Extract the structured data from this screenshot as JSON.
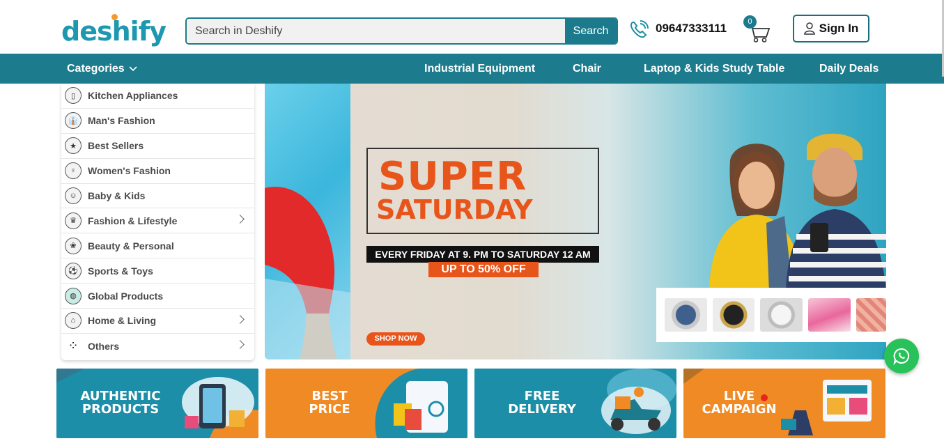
{
  "brand": {
    "logo_text": "deshify",
    "accent": "#1c7b8d",
    "orange": "#e8551b"
  },
  "search": {
    "placeholder": "Search in Deshify",
    "button_label": "Search"
  },
  "contact": {
    "phone": "09647333111",
    "icon": "phone-icon"
  },
  "cart": {
    "count": "0",
    "icon": "cart-icon"
  },
  "account": {
    "signin_label": "Sign In",
    "icon": "user-icon"
  },
  "nav": {
    "categories_label": "Categories",
    "items": [
      {
        "label": "Industrial Equipment"
      },
      {
        "label": "Chair"
      },
      {
        "label": "Laptop & Kids Study Table"
      },
      {
        "label": "Daily Deals"
      }
    ]
  },
  "sidebar": {
    "items": [
      {
        "label": "Kitchen Appliances",
        "icon": "kitchen-icon",
        "has_submenu": false
      },
      {
        "label": "Man's Fashion",
        "icon": "shirt-icon",
        "has_submenu": false
      },
      {
        "label": "Best Sellers",
        "icon": "trophy-icon",
        "has_submenu": false
      },
      {
        "label": "Women's Fashion",
        "icon": "dress-icon",
        "has_submenu": false
      },
      {
        "label": "Baby & Kids",
        "icon": "baby-icon",
        "has_submenu": false
      },
      {
        "label": "Fashion & Lifestyle",
        "icon": "fashion-icon",
        "has_submenu": true
      },
      {
        "label": "Beauty & Personal",
        "icon": "beauty-icon",
        "has_submenu": false
      },
      {
        "label": "Sports & Toys",
        "icon": "sports-icon",
        "has_submenu": false
      },
      {
        "label": "Global Products",
        "icon": "globe-icon",
        "has_submenu": false
      },
      {
        "label": "Home & Living",
        "icon": "home-icon",
        "has_submenu": true
      },
      {
        "label": "Others",
        "icon": "dots-icon",
        "has_submenu": true
      }
    ]
  },
  "banner": {
    "title_line1": "SUPER",
    "title_line2": "SATURDAY",
    "subtitle": "EVERY FRIDAY AT 9. PM  TO SATURDAY 12 AM",
    "offer": "UP TO 50% OFF",
    "cta": "SHOP NOW"
  },
  "features": [
    {
      "line1": "AUTHENTIC",
      "line2": "PRODUCTS",
      "color": "#1d8ea8"
    },
    {
      "line1": "BEST",
      "line2": "PRICE",
      "color": "#f08a24"
    },
    {
      "line1": "FREE",
      "line2": "DELIVERY",
      "color": "#1d8ea8"
    },
    {
      "line1": "LIVE",
      "line2": "CAMPAIGN",
      "color": "#f08a24"
    }
  ]
}
